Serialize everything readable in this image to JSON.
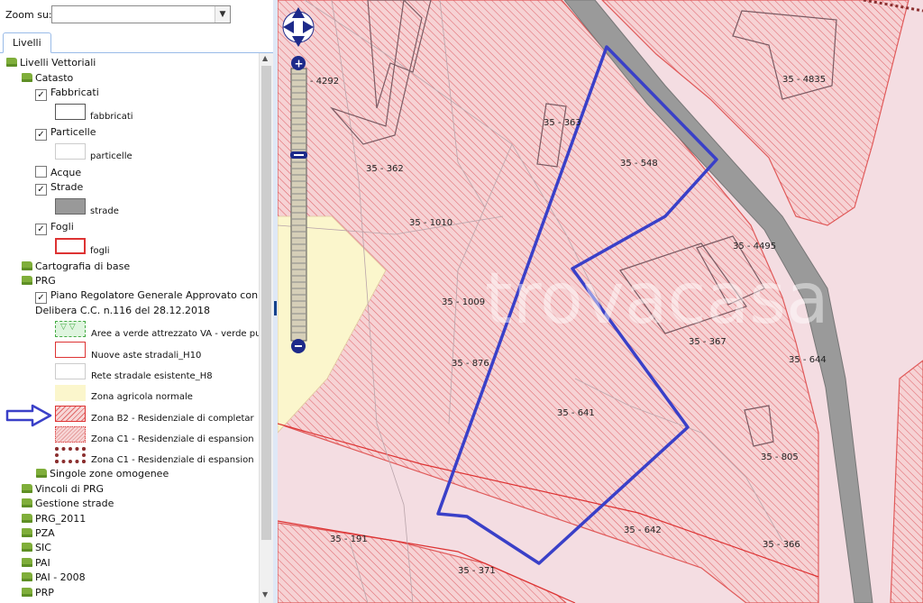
{
  "zoom": {
    "label": "Zoom su:",
    "value": ""
  },
  "tabs": [
    {
      "label": "Livelli"
    }
  ],
  "tree": {
    "root": "Livelli Vettoriali",
    "catasto": "Catasto",
    "fabbricati": {
      "label": "Fabbricati",
      "legend": "fabbricati",
      "checked": true
    },
    "particelle": {
      "label": "Particelle",
      "legend": "particelle",
      "checked": true
    },
    "acque": {
      "label": "Acque",
      "checked": false
    },
    "strade": {
      "label": "Strade",
      "legend": "strade",
      "checked": true
    },
    "fogli": {
      "label": "Fogli",
      "legend": "fogli",
      "checked": true
    },
    "cartografia": "Cartografia di base",
    "prg": "PRG",
    "prg_layer": {
      "line1": "Piano Regolatore Generale Approvato con",
      "line2": "Delibera C.C. n.116 del 28.12.2018",
      "checked": true
    },
    "legend": [
      "Aree a verde attrezzato VA - verde pu",
      "Nuove aste stradali_H10",
      "Rete stradale esistente_H8",
      "Zona agricola normale",
      "Zona B2 - Residenziale di completar",
      "Zona C1 - Residenziale di espansion",
      "Zona C1 - Residenziale di espansion"
    ],
    "singole": "Singole zone omogenee",
    "groups": [
      "Vincoli di PRG",
      "Gestione strade",
      "PRG_2011",
      "PZA",
      "SIC",
      "PAI",
      "PAI - 2008",
      "PRP"
    ]
  },
  "map": {
    "watermark": "trovacasa",
    "parcels": [
      "35 - 4292",
      "35 - 362",
      "35 - 363",
      "35 - 548",
      "35 - 4835",
      "35 - 1010",
      "35 - 4495",
      "35 - 1009",
      "35 - 367",
      "35 - 876",
      "35 - 644",
      "35 - 641",
      "35 - 805",
      "35 - 191",
      "35 - 642",
      "35 - 366",
      "35 - 371"
    ]
  },
  "colors": {
    "zone_b2": "#e05a5a",
    "selection": "#3a40c8",
    "road": "#9a9a9a",
    "agricola": "#fbf6cc",
    "accent": "#15428b"
  }
}
